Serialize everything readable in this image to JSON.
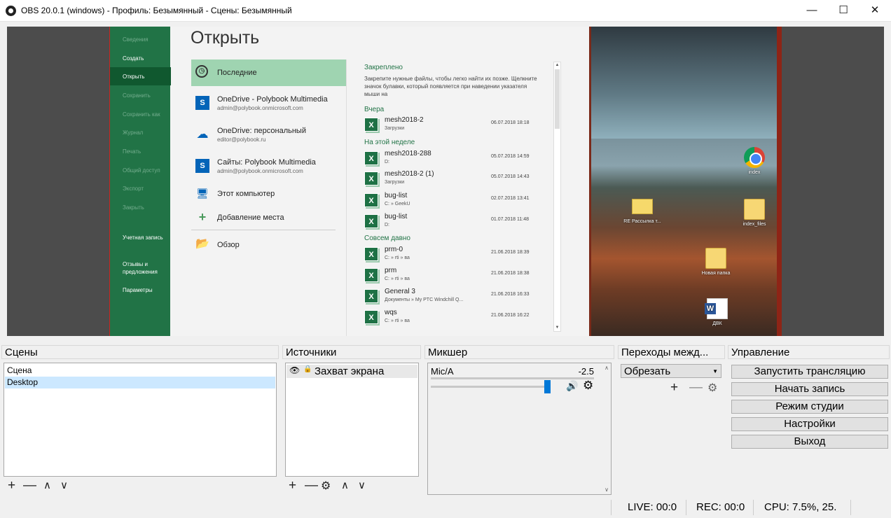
{
  "window": {
    "title": "OBS 20.0.1 (windows) - Профиль: Безымянный - Сцены: Безымянный",
    "minimize": "—",
    "maximize": "☐",
    "close": "✕"
  },
  "preview": {
    "excel": {
      "sidebar": [
        "Сведения",
        "Создать",
        "Открыть",
        "Сохранить",
        "Сохранить как",
        "Журнал",
        "Печать",
        "Общий доступ",
        "Экспорт",
        "Закрыть",
        "Учетная запись",
        "Отзывы и предложения",
        "Параметры"
      ],
      "heading": "Открыть",
      "locations": [
        {
          "name": "Последние",
          "sub": ""
        },
        {
          "name": "OneDrive - Polybook Multimedia",
          "sub": "admin@polybook.onmicrosoft.com"
        },
        {
          "name": "OneDrive: персональный",
          "sub": "editor@polybook.ru"
        },
        {
          "name": "Сайты: Polybook Multimedia",
          "sub": "admin@polybook.onmicrosoft.com"
        },
        {
          "name": "Этот компьютер",
          "sub": ""
        },
        {
          "name": "Добавление места",
          "sub": ""
        },
        {
          "name": "Обзор",
          "sub": ""
        }
      ],
      "pinned_title": "Закреплено",
      "pinned_note": "Закрепите нужные файлы, чтобы легко найти их позже. Щелкните значок булавки, который появляется при наведении указателя мыши на",
      "groups": [
        "Вчера",
        "На этой неделе",
        "Совсем давно"
      ],
      "files": [
        {
          "name": "mesh2018-2",
          "path": "Загрузки",
          "date": "06.07.2018 18:18"
        },
        {
          "name": "mesh2018-288",
          "path": "D:",
          "date": "05.07.2018 14:59"
        },
        {
          "name": "mesh2018-2 (1)",
          "path": "Загрузки",
          "date": "05.07.2018 14:43"
        },
        {
          "name": "bug-list",
          "path": "C: » GeekU",
          "date": "02.07.2018 13:41"
        },
        {
          "name": "bug-list",
          "path": "D:",
          "date": "01.07.2018 11:48"
        },
        {
          "name": "prm-0",
          "path": "C: » rti » ва",
          "date": "21.06.2018 18:39"
        },
        {
          "name": "prm",
          "path": "C: » rti » ва",
          "date": "21.06.2018 18:38"
        },
        {
          "name": "General 3",
          "path": "Документы » My PTC Windchill Q...",
          "date": "21.06.2018 16:33"
        },
        {
          "name": "wqs",
          "path": "C: » rti » ва",
          "date": "21.06.2018 16:22"
        }
      ]
    },
    "desktop_icons": [
      {
        "label": "index",
        "icon": "chrome-icon"
      },
      {
        "label": "RE Рассылка т...",
        "icon": "envelope-icon"
      },
      {
        "label": "index_files",
        "icon": "folder-icon"
      },
      {
        "label": "Новая папка",
        "icon": "folder-icon"
      },
      {
        "label": "ДВК",
        "icon": "word-doc-icon"
      }
    ]
  },
  "panels": {
    "scenes": {
      "title": "Сцены",
      "items": [
        "Сцена",
        "Desktop"
      ],
      "selected": 1
    },
    "sources": {
      "title": "Источники",
      "items": [
        "Захват экрана"
      ]
    },
    "mixer": {
      "title": "Микшер",
      "channel": "Mic/A",
      "level_db": "-2.5",
      "volume": 0.98
    },
    "transitions": {
      "title": "Переходы межд...",
      "selected": "Обрезать"
    },
    "controls": {
      "title": "Управление",
      "buttons": [
        "Запустить трансляцию",
        "Начать запись",
        "Режим студии",
        "Настройки",
        "Выход"
      ]
    }
  },
  "toolbar_glyphs": {
    "add": "+",
    "remove": "—",
    "up": "∧",
    "down": "∨",
    "settings": "⚙",
    "eye": "👁",
    "lock": "🔒",
    "speaker": "🔊"
  },
  "status": {
    "live": "LIVE: 00:0",
    "rec": "REC: 00:0",
    "cpu": "CPU: 7.5%, 25."
  }
}
